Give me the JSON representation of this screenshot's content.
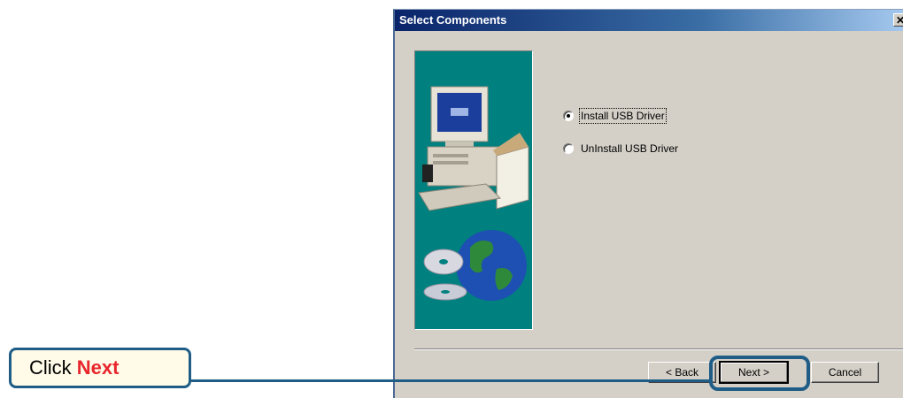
{
  "dialog": {
    "title": "Select Components",
    "close_glyph": "✕"
  },
  "options": [
    {
      "label": "Install USB Driver",
      "checked": true
    },
    {
      "label": "UnInstall USB Driver",
      "checked": false
    }
  ],
  "buttons": {
    "back": "Back",
    "next": "Next",
    "cancel": "Cancel"
  },
  "callout": {
    "prefix": "Click ",
    "highlight": "Next"
  },
  "colors": {
    "teal_panel": "#00807f",
    "callout_border": "#1f5d87",
    "callout_highlight": "#e8262d"
  }
}
